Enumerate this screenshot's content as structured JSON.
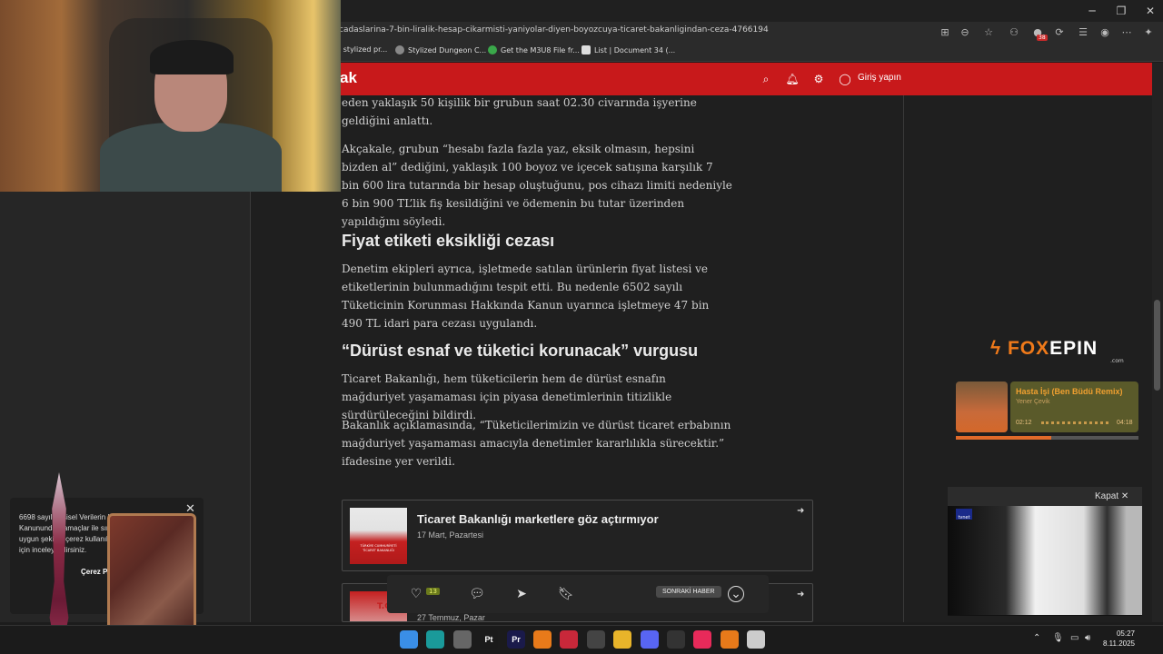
{
  "browser": {
    "url": "cadaslarina-7-bin-liralik-hesap-cikarmisti-yaniyolar-diyen-boyozcuya-ticaret-bakanligindan-ceza-4766194",
    "bookmarks": [
      {
        "label": "l stylized pr...",
        "color": "#555555"
      },
      {
        "label": "Stylized Dungeon C...",
        "color": "#888888"
      },
      {
        "label": "Get the M3U8 File fr...",
        "color": "#3aa84a"
      },
      {
        "label": "List | Document 34 (...",
        "color": "#dddddd"
      }
    ],
    "extension_badge": "38",
    "window_controls": {
      "minimize": "─",
      "maximize": "❐",
      "close": "✕"
    }
  },
  "site": {
    "logo": "ak",
    "login_label": "Giriş yapın",
    "icons": {
      "search": "⌕",
      "notifications": "🔔︎",
      "settings": "⚙︎",
      "account": "◯"
    }
  },
  "article": {
    "paragraphs": [
      "eden yaklaşık 50 kişilik bir grubun saat 02.30 civarında işyerine geldiğini anlattı.",
      "Akçakale, grubun “hesabı fazla fazla yaz, eksik olmasın, hepsini bizden al” dediğini, yaklaşık 100 boyoz ve içecek satışına karşılık 7 bin 600 lira tutarında bir hesap oluştuğunu, pos cihazı limiti nedeniyle 6 bin 900 TL’lik fiş kesildiğini ve ödemenin bu tutar üzerinden yapıldığını söyledi.",
      "Denetim ekipleri ayrıca, işletmede satılan ürünlerin fiyat listesi ve etiketlerinin bulunmadığını tespit etti. Bu nedenle 6502 sayılı Tüketicinin Korunması Hakkında Kanun uyarınca işletmeye 47 bin 490 TL idari para cezası uygulandı.",
      "Ticaret Bakanlığı, hem tüketicilerin hem de dürüst esnafın mağduriyet yaşamaması için piyasa denetimlerinin titizlikle sürdürüleceğini bildirdi.",
      "Bakanlık açıklamasında, “Tüketicilerimizin ve dürüst ticaret erbabının mağduriyet yaşamaması amacıyla denetimler kararlılıkla sürecektir.” ifadesine yer verildi."
    ],
    "headings": [
      "Fiyat etiketi eksikliği cezası",
      "“Dürüst esnaf ve tüketici korunacak” vurgusu"
    ],
    "related": [
      {
        "title": "Ticaret Bakanlığı marketlere göz açtırmıyor",
        "date": "17 Mart, Pazartesi",
        "thumb_text": "TÜRKİYE CUMHURİYETİ TİCARET BAKANLIĞI"
      },
      {
        "title": "",
        "date": "27 Temmuz, Pazar",
        "thumb_text": "T.C."
      }
    ]
  },
  "action_bar": {
    "like_count": "13",
    "next_label": "SONRAKİ HABER",
    "icons": {
      "like": "♡",
      "comment": "💬︎",
      "share": "➤",
      "bookmark": "🔖︎",
      "down": "⌄"
    }
  },
  "cookie_notice": {
    "text": "6698 sayılı Kişisel Verilerin Korunması Kanunundaki amaçlar ile sınırlı ve mevzuata uygun şekilde çerez kullanılmaktadır. Detaylı bilgi için inceleyebilirsiniz.",
    "button": "Çerez P...",
    "close": "✕"
  },
  "widgets": {
    "foxepin_logo_a": "FOX",
    "foxepin_logo_b": "EPIN",
    "foxepin_sub": ".com",
    "music": {
      "title": "Hasta İşi (Ben Büdü Remix)",
      "artist": "Yener Çevik",
      "elapsed": "02:12",
      "total": "04:18",
      "progress": 0.52
    },
    "video": {
      "close_label": "Kapat",
      "channel": "tvnet"
    }
  },
  "taskbar": {
    "apps": [
      {
        "name": "windows-start",
        "label": "",
        "color": "#3a8ee6"
      },
      {
        "name": "edge",
        "label": "",
        "color": "#1a9a9a"
      },
      {
        "name": "photos",
        "label": "",
        "color": "#666666"
      },
      {
        "name": "pycharm",
        "label": "Pt",
        "color": "#1a1a1a"
      },
      {
        "name": "premiere",
        "label": "Pr",
        "color": "#1a1a4a"
      },
      {
        "name": "blender",
        "label": "",
        "color": "#e87a1a"
      },
      {
        "name": "recorder",
        "label": "",
        "color": "#c8283a"
      },
      {
        "name": "search-app",
        "label": "",
        "color": "#444444"
      },
      {
        "name": "explorer",
        "label": "",
        "color": "#e8b42a"
      },
      {
        "name": "discord",
        "label": "",
        "color": "#5865f2"
      },
      {
        "name": "obs",
        "label": "",
        "color": "#333333"
      },
      {
        "name": "player",
        "label": "",
        "color": "#e82a5a"
      },
      {
        "name": "blender-2",
        "label": "",
        "color": "#e87a1a"
      },
      {
        "name": "steam",
        "label": "",
        "color": "#cccccc"
      }
    ],
    "time": "05:27",
    "date": "8.11.2025"
  }
}
